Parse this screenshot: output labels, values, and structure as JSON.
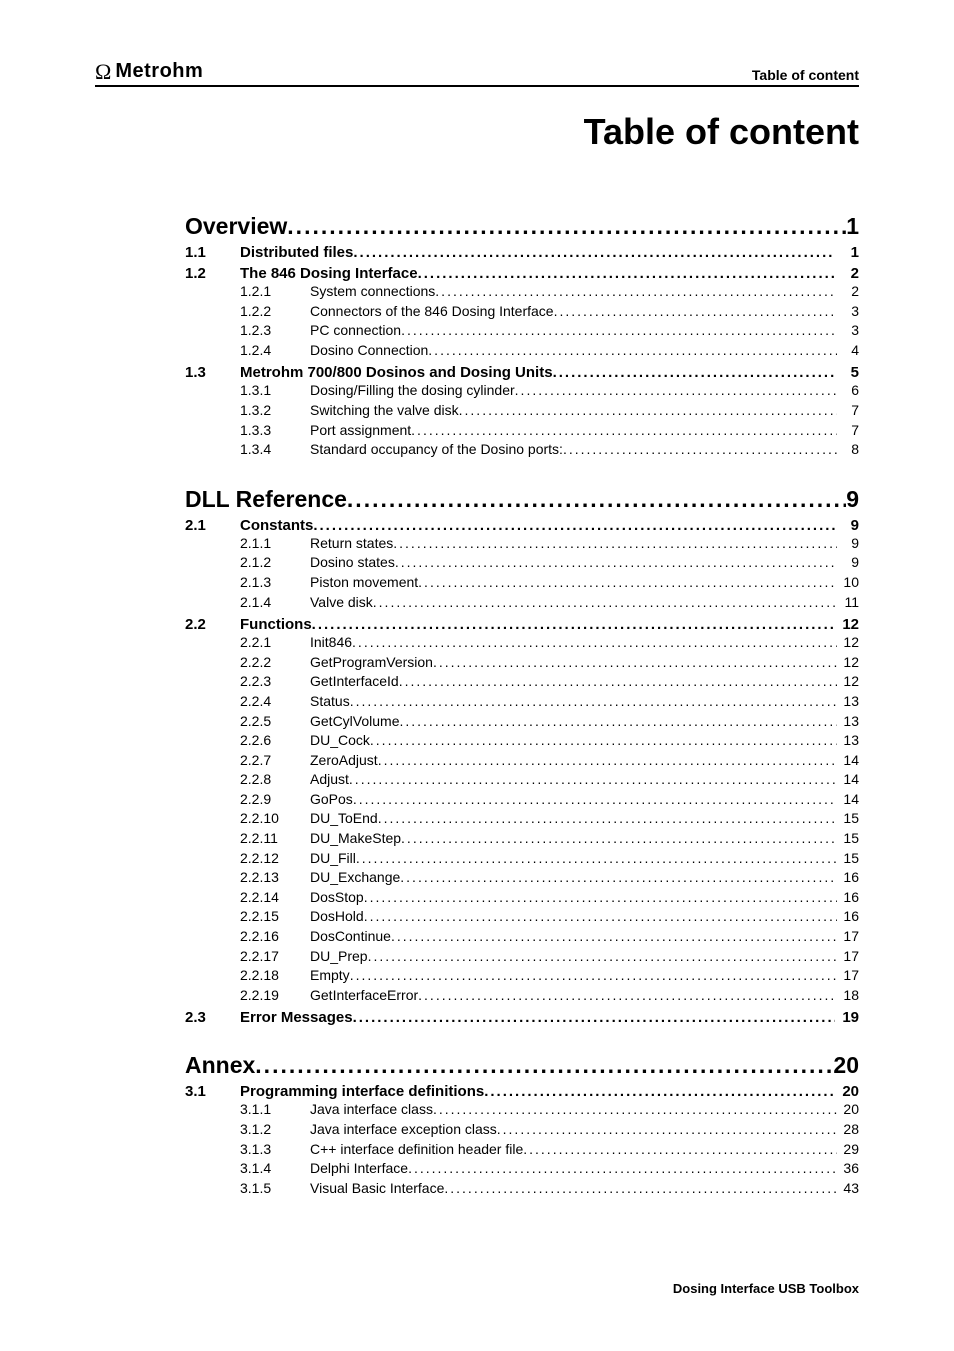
{
  "header": {
    "brand_symbol": "Ω",
    "brand_name": "Metrohm",
    "section_label": "Table of content"
  },
  "title": "Table of content",
  "footer": "Dosing Interface USB Toolbox",
  "toc": [
    {
      "level": 1,
      "num": "1",
      "title": "Overview",
      "page": "1"
    },
    {
      "level": 2,
      "num": "1.1",
      "title": "Distributed files",
      "page": "1"
    },
    {
      "level": 2,
      "num": "1.2",
      "title": "The 846 Dosing Interface",
      "page": "2"
    },
    {
      "level": 3,
      "num": "1.2.1",
      "title": "System connections",
      "page": "2"
    },
    {
      "level": 3,
      "num": "1.2.2",
      "title": "Connectors of the 846 Dosing Interface",
      "page": "3"
    },
    {
      "level": 3,
      "num": "1.2.3",
      "title": "PC connection",
      "page": "3"
    },
    {
      "level": 3,
      "num": "1.2.4",
      "title": "Dosino Connection",
      "page": "4"
    },
    {
      "level": 2,
      "num": "1.3",
      "title": "Metrohm 700/800 Dosinos and Dosing Units",
      "page": "5"
    },
    {
      "level": 3,
      "num": "1.3.1",
      "title": "Dosing/Filling the dosing cylinder",
      "page": "6"
    },
    {
      "level": 3,
      "num": "1.3.2",
      "title": "Switching the valve disk",
      "page": "7"
    },
    {
      "level": 3,
      "num": "1.3.3",
      "title": "Port assignment",
      "page": "7"
    },
    {
      "level": 3,
      "num": "1.3.4",
      "title": "Standard occupancy of the Dosino ports:",
      "page": "8"
    },
    {
      "level": 1,
      "num": "2",
      "title": "DLL Reference",
      "page": "9"
    },
    {
      "level": 2,
      "num": "2.1",
      "title": "Constants",
      "page": "9"
    },
    {
      "level": 3,
      "num": "2.1.1",
      "title": "Return states",
      "page": "9"
    },
    {
      "level": 3,
      "num": "2.1.2",
      "title": "Dosino states",
      "page": "9"
    },
    {
      "level": 3,
      "num": "2.1.3",
      "title": "Piston movement",
      "page": "10"
    },
    {
      "level": 3,
      "num": "2.1.4",
      "title": "Valve disk",
      "page": "11"
    },
    {
      "level": 2,
      "num": "2.2",
      "title": "Functions",
      "page": "12"
    },
    {
      "level": 3,
      "num": "2.2.1",
      "title": "Init846",
      "page": "12"
    },
    {
      "level": 3,
      "num": "2.2.2",
      "title": "GetProgramVersion",
      "page": "12"
    },
    {
      "level": 3,
      "num": "2.2.3",
      "title": "GetInterfaceId",
      "page": "12"
    },
    {
      "level": 3,
      "num": "2.2.4",
      "title": "Status",
      "page": "13"
    },
    {
      "level": 3,
      "num": "2.2.5",
      "title": "GetCylVolume",
      "page": "13"
    },
    {
      "level": 3,
      "num": "2.2.6",
      "title": "DU_Cock",
      "page": "13"
    },
    {
      "level": 3,
      "num": "2.2.7",
      "title": "ZeroAdjust",
      "page": "14"
    },
    {
      "level": 3,
      "num": "2.2.8",
      "title": "Adjust",
      "page": "14"
    },
    {
      "level": 3,
      "num": "2.2.9",
      "title": "GoPos",
      "page": "14"
    },
    {
      "level": 3,
      "num": "2.2.10",
      "title": "DU_ToEnd",
      "page": "15"
    },
    {
      "level": 3,
      "num": "2.2.11",
      "title": "DU_MakeStep",
      "page": "15"
    },
    {
      "level": 3,
      "num": "2.2.12",
      "title": "DU_Fill",
      "page": "15"
    },
    {
      "level": 3,
      "num": "2.2.13",
      "title": "DU_Exchange",
      "page": "16"
    },
    {
      "level": 3,
      "num": "2.2.14",
      "title": "DosStop",
      "page": "16"
    },
    {
      "level": 3,
      "num": "2.2.15",
      "title": "DosHold",
      "page": "16"
    },
    {
      "level": 3,
      "num": "2.2.16",
      "title": "DosContinue",
      "page": "17"
    },
    {
      "level": 3,
      "num": "2.2.17",
      "title": "DU_Prep",
      "page": "17"
    },
    {
      "level": 3,
      "num": "2.2.18",
      "title": "Empty",
      "page": "17"
    },
    {
      "level": 3,
      "num": "2.2.19",
      "title": "GetInterfaceError",
      "page": "18"
    },
    {
      "level": 2,
      "num": "2.3",
      "title": "Error Messages",
      "page": "19"
    },
    {
      "level": 1,
      "num": "3",
      "title": "Annex",
      "page": "20"
    },
    {
      "level": 2,
      "num": "3.1",
      "title": "Programming interface definitions",
      "page": "20"
    },
    {
      "level": 3,
      "num": "3.1.1",
      "title": "Java interface class",
      "page": "20"
    },
    {
      "level": 3,
      "num": "3.1.2",
      "title": "Java interface exception class",
      "page": "28"
    },
    {
      "level": 3,
      "num": "3.1.3",
      "title": "C++ interface definition header file",
      "page": "29"
    },
    {
      "level": 3,
      "num": "3.1.4",
      "title": "Delphi Interface",
      "page": "36"
    },
    {
      "level": 3,
      "num": "3.1.5",
      "title": "Visual Basic Interface",
      "page": "43"
    }
  ]
}
